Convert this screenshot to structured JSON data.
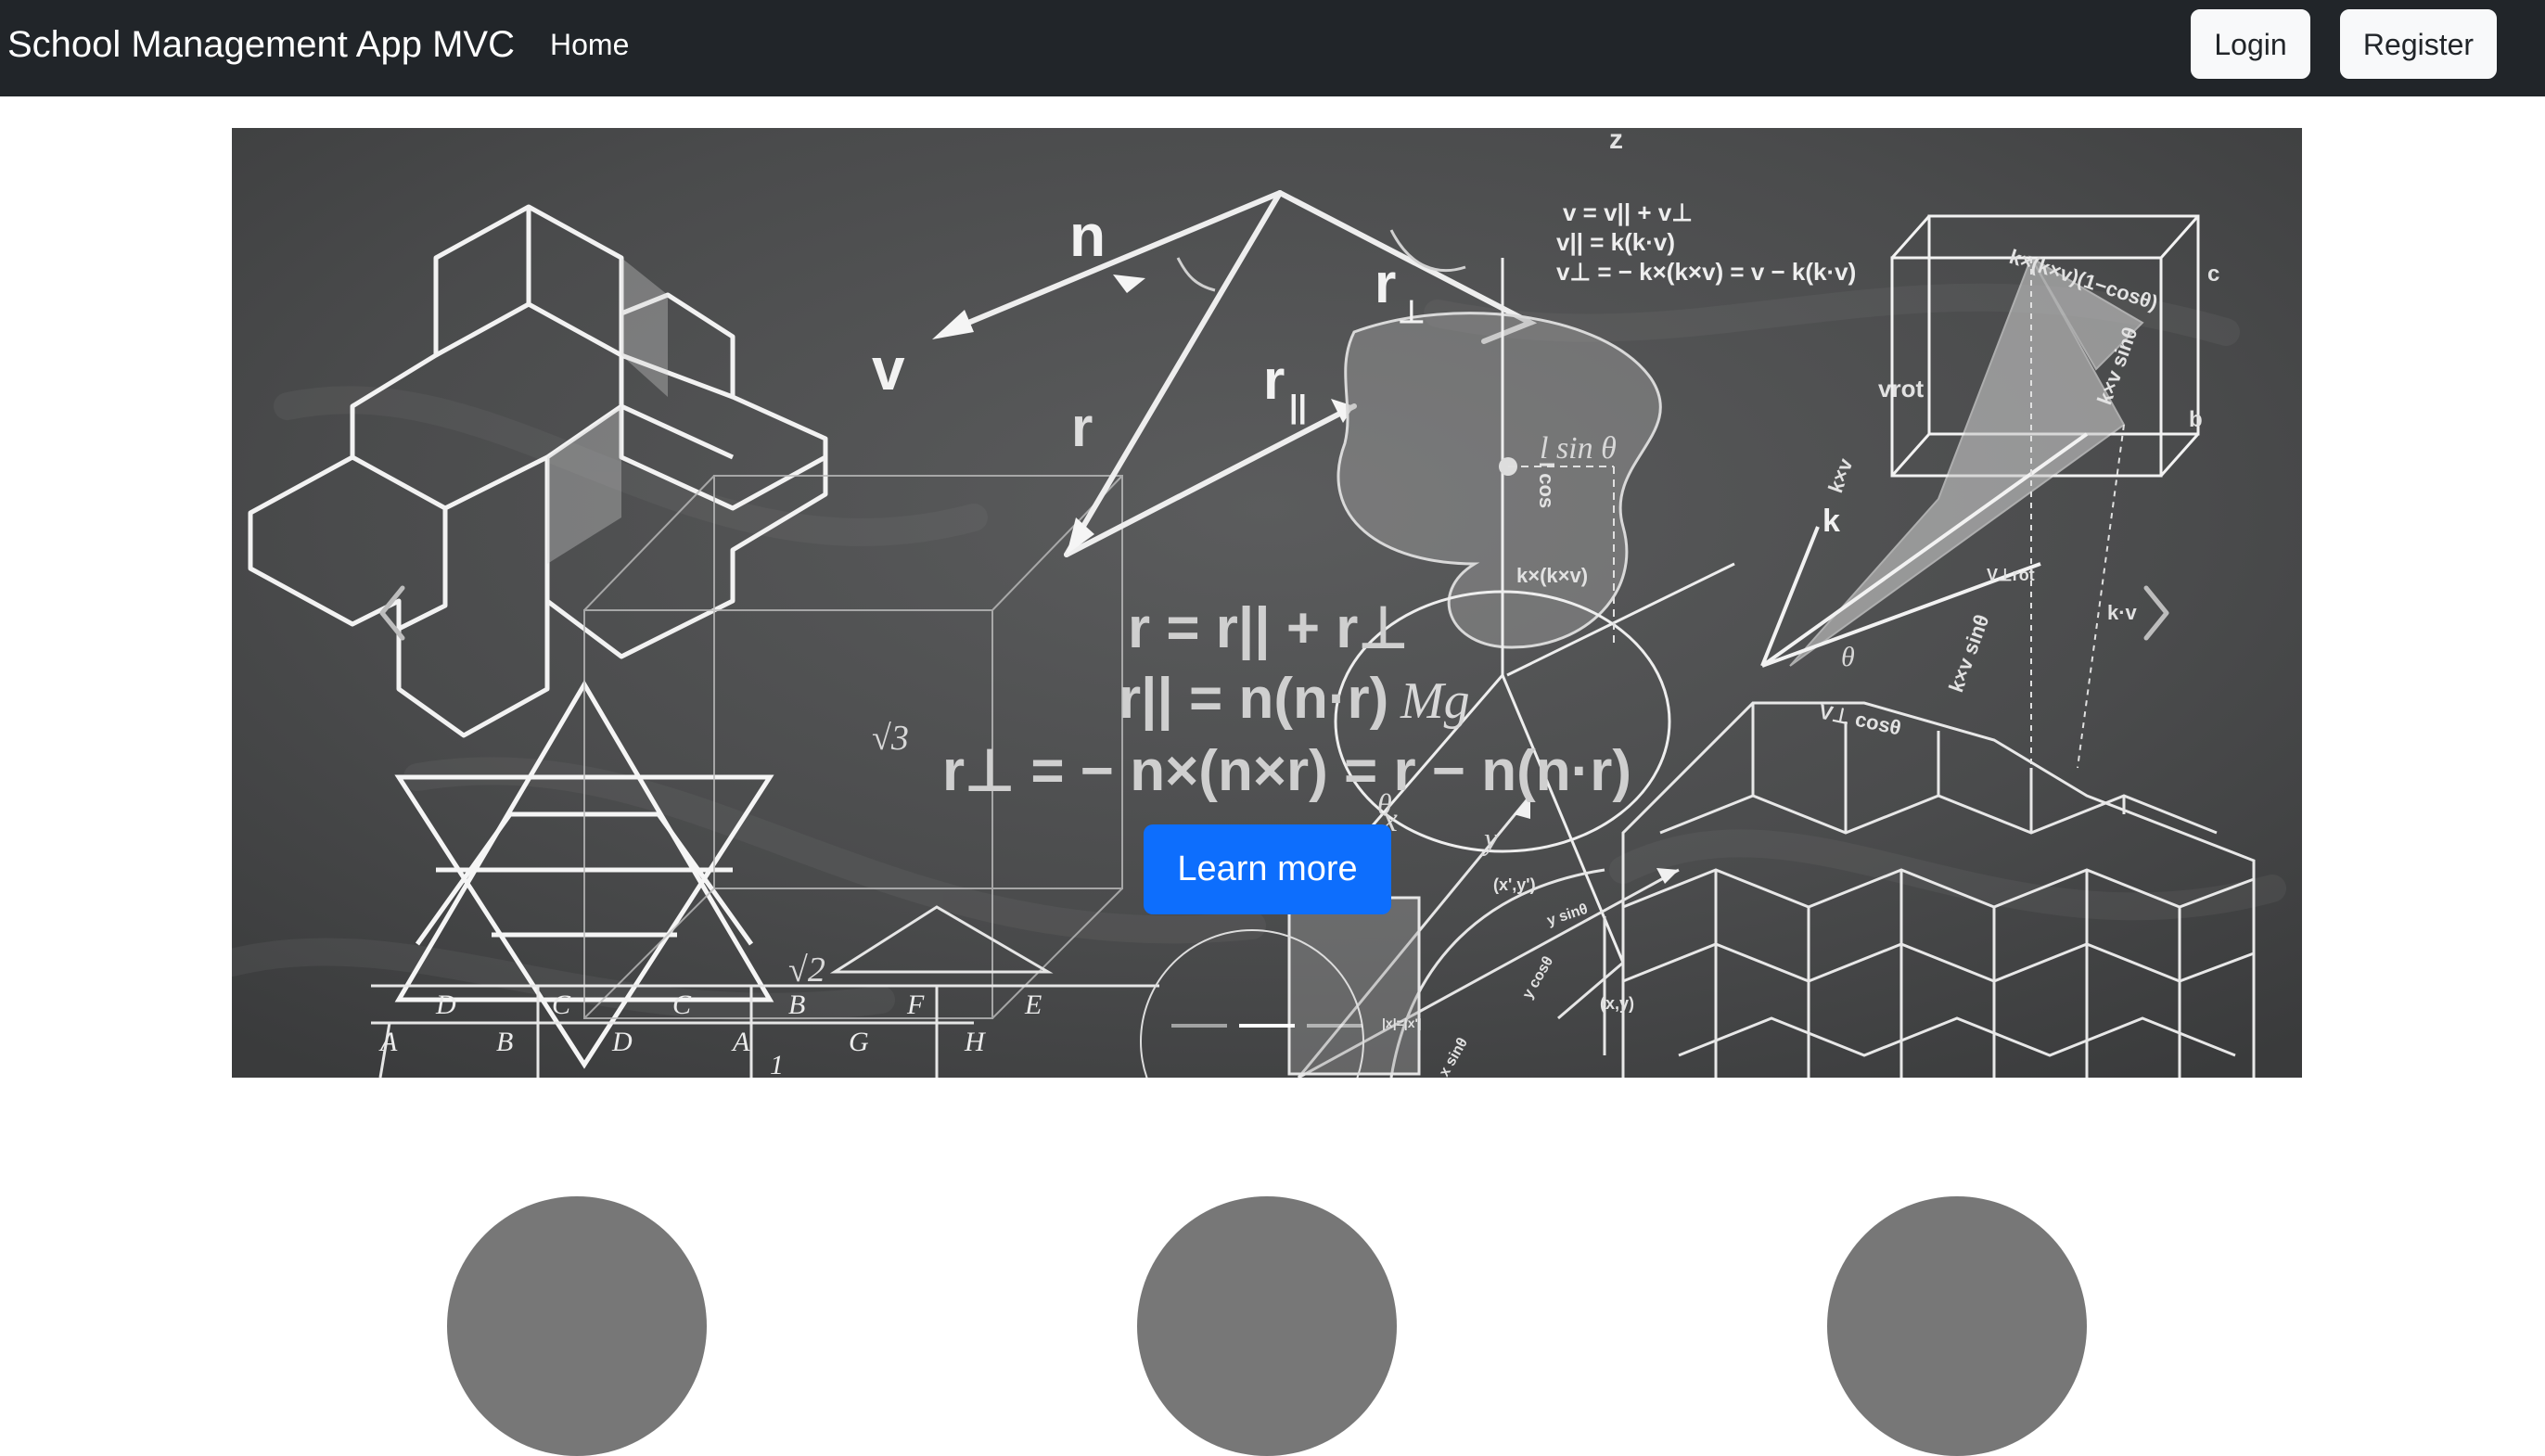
{
  "navbar": {
    "brand": "School Management App MVC",
    "home_label": "Home",
    "login_label": "Login",
    "register_label": "Register"
  },
  "carousel": {
    "cta_label": "Learn more",
    "prev_icon": "chevron-left-icon",
    "next_icon": "chevron-right-icon",
    "slide_count": 3,
    "active_slide": 2,
    "background": "chalkboard math illustration",
    "chalk_text": {
      "n": "n",
      "v": "v",
      "r": "r",
      "r_par": "r",
      "r_par_sub": "||",
      "r_perp": "r",
      "r_perp_sub": "⊥",
      "eq1": "v = v|| + v⊥",
      "eq2": "v|| = k(k·v)",
      "eq3": "v⊥ = − k×(k×v) = v − k(k·v)",
      "eq_main1": "r = r|| + r⊥",
      "eq_main2": "r|| = n(n·r)",
      "eq_main3": "r⊥ = − n×(n×r) = r − n(n·r)",
      "mg": "Mg",
      "lsin": "l sin θ",
      "lcos": "l cos",
      "kxkv": "k×(k×v)",
      "kxkv_cos": "k×(k×v)(1−cosθ)",
      "kxv": "k×v",
      "kxv_sin": "k×v sinθ",
      "kv": "k·v",
      "vrot": "vrot",
      "v_perp_rot": "V⊥rot",
      "k": "k",
      "theta": "θ",
      "vcos": "V⊥ cosθ",
      "sqrt3": "√3",
      "sqrt2": "√2",
      "x": "x",
      "y": "y",
      "xy1": "(x',y')",
      "xy2": "(x,y)",
      "ysin": "y sinθ",
      "ycos": "y cosθ",
      "xsin": "x sinθ",
      "absx": "|x|=|x'|",
      "letters": [
        "D",
        "C",
        "C",
        "B",
        "F",
        "E",
        "A",
        "B",
        "D",
        "A",
        "G",
        "H",
        "1"
      ],
      "cube_b": "b",
      "cube_c": "c",
      "z": "z"
    }
  },
  "colors": {
    "navbar_bg": "#212529",
    "primary": "#0d6efd",
    "circle": "#777777",
    "chalkboard": "#4b4c4d"
  }
}
